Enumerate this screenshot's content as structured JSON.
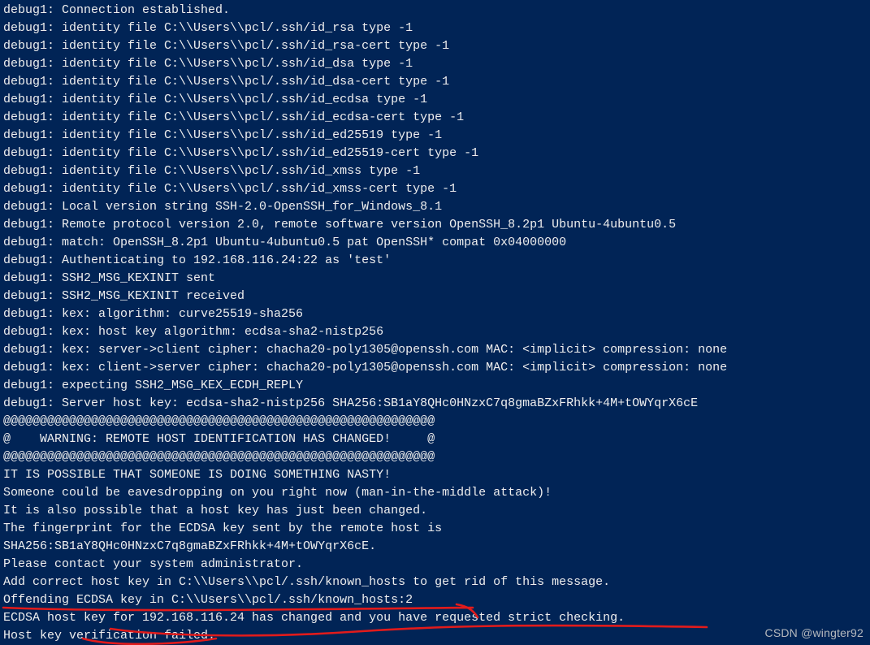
{
  "terminal": {
    "lines": [
      "debug1: Connection established.",
      "debug1: identity file C:\\\\Users\\\\pcl/.ssh/id_rsa type -1",
      "debug1: identity file C:\\\\Users\\\\pcl/.ssh/id_rsa-cert type -1",
      "debug1: identity file C:\\\\Users\\\\pcl/.ssh/id_dsa type -1",
      "debug1: identity file C:\\\\Users\\\\pcl/.ssh/id_dsa-cert type -1",
      "debug1: identity file C:\\\\Users\\\\pcl/.ssh/id_ecdsa type -1",
      "debug1: identity file C:\\\\Users\\\\pcl/.ssh/id_ecdsa-cert type -1",
      "debug1: identity file C:\\\\Users\\\\pcl/.ssh/id_ed25519 type -1",
      "debug1: identity file C:\\\\Users\\\\pcl/.ssh/id_ed25519-cert type -1",
      "debug1: identity file C:\\\\Users\\\\pcl/.ssh/id_xmss type -1",
      "debug1: identity file C:\\\\Users\\\\pcl/.ssh/id_xmss-cert type -1",
      "debug1: Local version string SSH-2.0-OpenSSH_for_Windows_8.1",
      "debug1: Remote protocol version 2.0, remote software version OpenSSH_8.2p1 Ubuntu-4ubuntu0.5",
      "debug1: match: OpenSSH_8.2p1 Ubuntu-4ubuntu0.5 pat OpenSSH* compat 0x04000000",
      "debug1: Authenticating to 192.168.116.24:22 as 'test'",
      "debug1: SSH2_MSG_KEXINIT sent",
      "debug1: SSH2_MSG_KEXINIT received",
      "debug1: kex: algorithm: curve25519-sha256",
      "debug1: kex: host key algorithm: ecdsa-sha2-nistp256",
      "debug1: kex: server->client cipher: chacha20-poly1305@openssh.com MAC: <implicit> compression: none",
      "debug1: kex: client->server cipher: chacha20-poly1305@openssh.com MAC: <implicit> compression: none",
      "debug1: expecting SSH2_MSG_KEX_ECDH_REPLY",
      "debug1: Server host key: ecdsa-sha2-nistp256 SHA256:SB1aY8QHc0HNzxC7q8gmaBZxFRhkk+4M+tOWYqrX6cE",
      "@@@@@@@@@@@@@@@@@@@@@@@@@@@@@@@@@@@@@@@@@@@@@@@@@@@@@@@@@@@",
      "@    WARNING: REMOTE HOST IDENTIFICATION HAS CHANGED!     @",
      "@@@@@@@@@@@@@@@@@@@@@@@@@@@@@@@@@@@@@@@@@@@@@@@@@@@@@@@@@@@",
      "IT IS POSSIBLE THAT SOMEONE IS DOING SOMETHING NASTY!",
      "Someone could be eavesdropping on you right now (man-in-the-middle attack)!",
      "It is also possible that a host key has just been changed.",
      "The fingerprint for the ECDSA key sent by the remote host is",
      "SHA256:SB1aY8QHc0HNzxC7q8gmaBZxFRhkk+4M+tOWYqrX6cE.",
      "Please contact your system administrator.",
      "Add correct host key in C:\\\\Users\\\\pcl/.ssh/known_hosts to get rid of this message.",
      "Offending ECDSA key in C:\\\\Users\\\\pcl/.ssh/known_hosts:2",
      "ECDSA host key for 192.168.116.24 has changed and you have requested strict checking.",
      "Host key verification failed."
    ]
  },
  "watermark": "CSDN @wingter92"
}
